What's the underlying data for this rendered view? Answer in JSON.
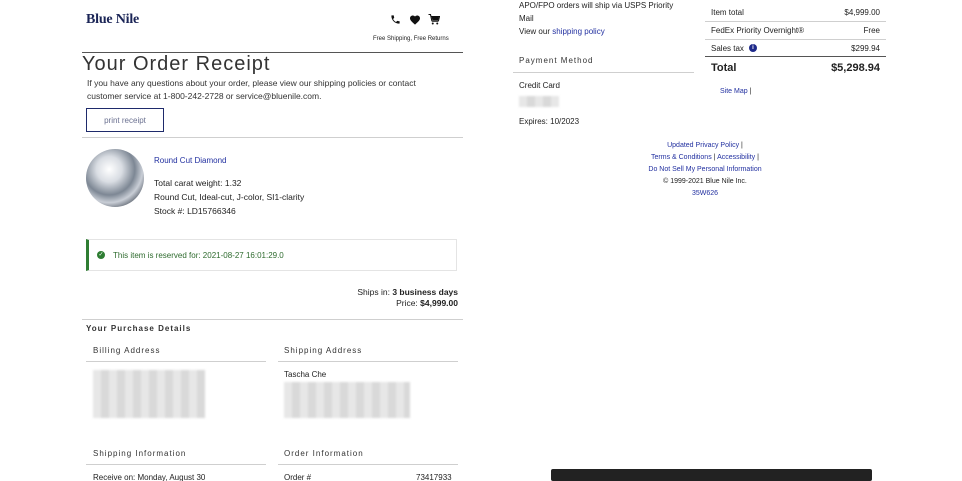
{
  "header": {
    "logo": "Blue Nile",
    "shipping_note": "Free Shipping, Free Returns"
  },
  "receipt": {
    "title": "Your Order Receipt",
    "help_line1": "If you have any questions about your order, please view our shipping policies or contact",
    "help_line2": "customer service at 1-800-242-2728 or service@bluenile.com.",
    "print_label": "print receipt"
  },
  "item": {
    "name": "Round Cut Diamond",
    "carat": "Total carat weight: 1.32",
    "specs": "Round Cut, Ideal-cut, J-color, SI1-clarity",
    "stock": "Stock #: LD15766346",
    "reserved": "This item is reserved for: 2021-08-27 16:01:29.0",
    "ships_label": "Ships in:",
    "ships_value": "3 business days",
    "price_label": "Price:",
    "price_value": "$4,999.00"
  },
  "purchase": {
    "heading": "Your Purchase Details",
    "billing_heading": "Billing Address",
    "shipping_heading": "Shipping Address",
    "shipping_name": "Tascha Che",
    "shipping_info_heading": "Shipping Information",
    "receive_on": "Receive on: Monday, August 30",
    "order_info_heading": "Order Information",
    "order_label": "Order #",
    "order_number": "73417933"
  },
  "middle": {
    "apo_line1": "APO/FPO orders will ship via USPS Priority",
    "apo_line2": "Mail",
    "view_prefix": "View our",
    "shipping_policy_link": "shipping policy",
    "payment_heading": "Payment Method",
    "card_type": "Credit Card",
    "expires": "Expires: 10/2023"
  },
  "summary": {
    "item_total_label": "Item total",
    "item_total_value": "$4,999.00",
    "shipping_label": "FedEx Priority Overnight®",
    "shipping_value": "Free",
    "tax_label": "Sales tax",
    "tax_value": "$299.94",
    "total_label": "Total",
    "total_value": "$5,298.94",
    "site_map": "Site Map",
    "sep": "|"
  },
  "footer": {
    "privacy": "Updated Privacy Policy",
    "terms": "Terms & Conditions",
    "accessibility": "Accessibility",
    "do_not_sell": "Do Not Sell My Personal Information",
    "copyright": "© 1999-2021 Blue Nile Inc.",
    "code": "35W626",
    "sep": "|"
  },
  "colors": {
    "brand_navy": "#1a2456",
    "link_blue": "#2230a0",
    "success_green": "#2e7d32"
  }
}
